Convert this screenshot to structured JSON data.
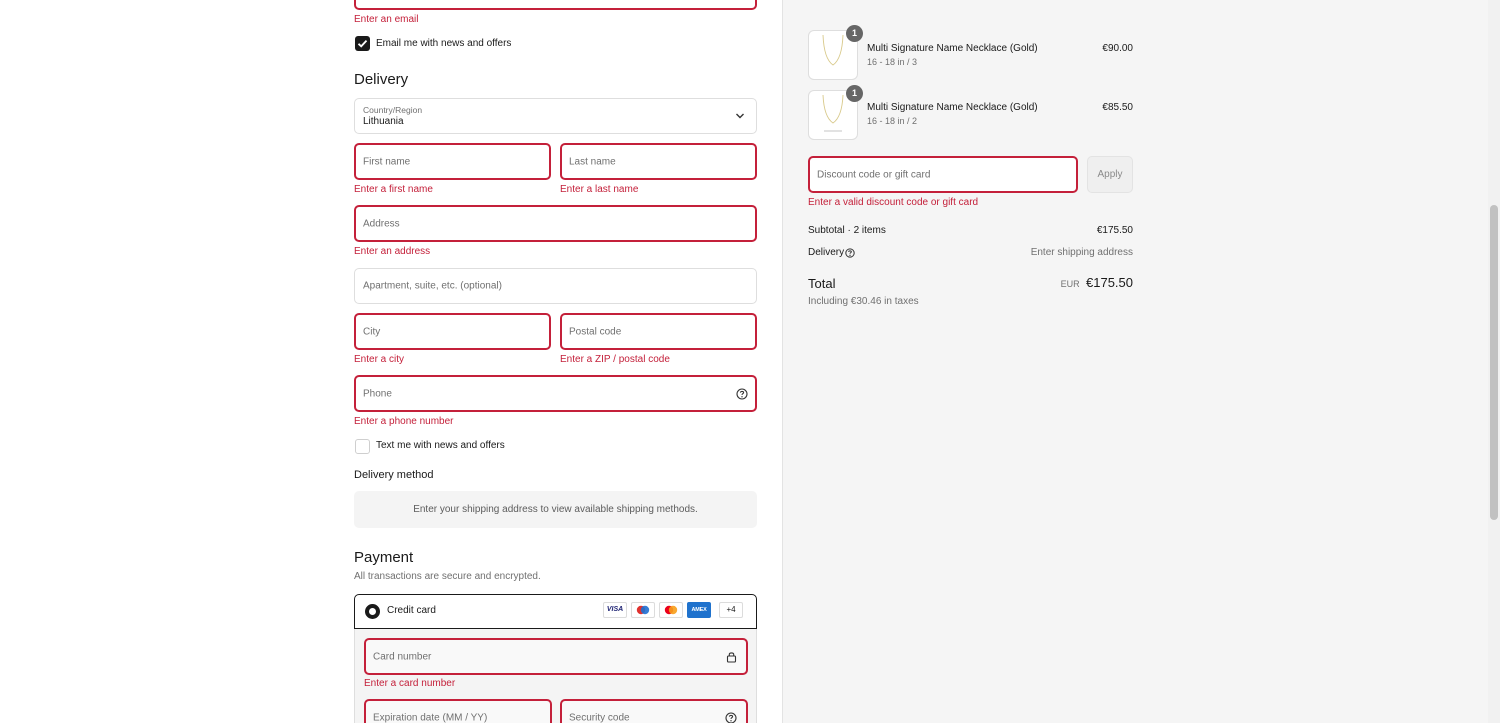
{
  "contact": {
    "email_error": "Enter an email",
    "newsletter_label": "Email me with news and offers"
  },
  "delivery": {
    "heading": "Delivery",
    "country_label": "Country/Region",
    "country_value": "Lithuania",
    "first_name_placeholder": "First name",
    "first_name_error": "Enter a first name",
    "last_name_placeholder": "Last name",
    "last_name_error": "Enter a last name",
    "address_placeholder": "Address",
    "address_error": "Enter an address",
    "apartment_placeholder": "Apartment, suite, etc. (optional)",
    "city_placeholder": "City",
    "city_error": "Enter a city",
    "postal_placeholder": "Postal code",
    "postal_error": "Enter a ZIP / postal code",
    "phone_placeholder": "Phone",
    "phone_error": "Enter a phone number",
    "sms_label": "Text me with news and offers",
    "method_heading": "Delivery method",
    "method_notice": "Enter your shipping address to view available shipping methods."
  },
  "payment": {
    "heading": "Payment",
    "subtitle": "All transactions are secure and encrypted.",
    "credit_card_label": "Credit card",
    "card_brands": [
      "VISA",
      "Maestro",
      "Mastercard",
      "AMEX"
    ],
    "more_brands": "+4",
    "card_number_placeholder": "Card number",
    "card_number_error": "Enter a card number",
    "expiration_placeholder": "Expiration date (MM / YY)",
    "security_placeholder": "Security code"
  },
  "summary": {
    "items": [
      {
        "quantity": "1",
        "name": "Multi Signature Name Necklace (Gold)",
        "variant": "16 - 18 in / 3",
        "price": "€90.00"
      },
      {
        "quantity": "1",
        "name": "Multi Signature Name Necklace (Gold)",
        "variant": "16 - 18 in / 2",
        "price": "€85.50"
      }
    ],
    "discount_placeholder": "Discount code or gift card",
    "apply_label": "Apply",
    "discount_error": "Enter a valid discount code or gift card",
    "subtotal_label": "Subtotal · 2 items",
    "subtotal_value": "€175.50",
    "delivery_label": "Delivery",
    "delivery_value": "Enter shipping address",
    "total_label": "Total",
    "currency": "EUR",
    "total_value": "€175.50",
    "tax_note": "Including €30.46 in taxes"
  },
  "colors": {
    "error": "#c4203a",
    "checkbox_checked": "#1a1a1a",
    "summary_bg": "#f5f5f5",
    "qty_badge": "#666666"
  }
}
